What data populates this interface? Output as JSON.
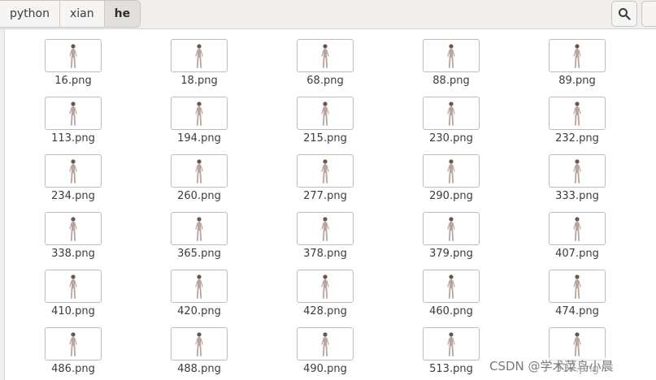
{
  "breadcrumbs": [
    {
      "label": "python",
      "active": false
    },
    {
      "label": "xian",
      "active": false
    },
    {
      "label": "he",
      "active": true
    }
  ],
  "toolbar": {
    "search_icon": "search-icon",
    "more_icon": "overflow-menu-icon"
  },
  "files": [
    "16.png",
    "18.png",
    "68.png",
    "88.png",
    "89.png",
    "113.png",
    "194.png",
    "215.png",
    "230.png",
    "232.png",
    "234.png",
    "260.png",
    "277.png",
    "290.png",
    "333.png",
    "338.png",
    "365.png",
    "378.png",
    "379.png",
    "407.png",
    "410.png",
    "420.png",
    "428.png",
    "460.png",
    "474.png",
    "486.png",
    "488.png",
    "490.png",
    "513.png",
    "517.png"
  ],
  "thumbnail_icon": "figure-image-thumbnail",
  "watermark": "CSDN @学术菜鸟小晨",
  "colors": {
    "header_bg": "#f0efec",
    "thumb_border": "#bdbdbd",
    "figure": "#b9a49e"
  }
}
